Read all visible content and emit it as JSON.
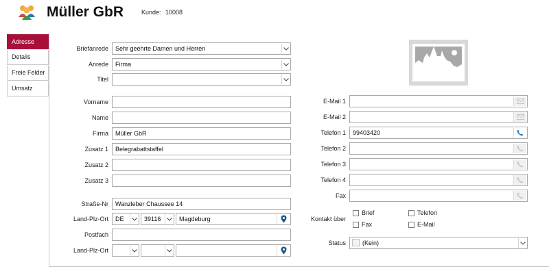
{
  "header": {
    "title": "Müller GbR",
    "kunde_label": "Kunde:",
    "kunde_number": "10008"
  },
  "tabs": [
    {
      "label": "Adresse",
      "active": true
    },
    {
      "label": "Details",
      "active": false
    },
    {
      "label": "Freie Felder",
      "active": false
    },
    {
      "label": "Umsatz",
      "active": false
    }
  ],
  "left_form": {
    "briefanrede": {
      "label": "Briefanrede",
      "value": "Sehr geehrte Damen und Herren"
    },
    "anrede": {
      "label": "Anrede",
      "value": "Firma"
    },
    "titel": {
      "label": "Titel",
      "value": ""
    },
    "vorname": {
      "label": "Vorname",
      "value": ""
    },
    "name": {
      "label": "Name",
      "value": ""
    },
    "firma": {
      "label": "Firma",
      "value": "Müller GbR"
    },
    "zusatz1": {
      "label": "Zusatz 1",
      "value": "Belegrabattstaffel"
    },
    "zusatz2": {
      "label": "Zusatz 2",
      "value": ""
    },
    "zusatz3": {
      "label": "Zusatz 3",
      "value": ""
    },
    "strasse": {
      "label": "Straße-Nr",
      "value": "Wanzleber Chaussee 14"
    },
    "land_plz_ort": {
      "label": "Land-Plz-Ort",
      "land": "DE",
      "plz": "39116",
      "ort": "Magdeburg"
    },
    "postfach": {
      "label": "Postfach",
      "value": ""
    },
    "land_plz_ort2": {
      "label": "Land-Plz-Ort",
      "land": "",
      "plz": "",
      "ort": ""
    }
  },
  "right_form": {
    "email1": {
      "label": "E-Mail 1",
      "value": ""
    },
    "email2": {
      "label": "E-Mail 2",
      "value": ""
    },
    "telefon1": {
      "label": "Telefon 1",
      "value": "99403420"
    },
    "telefon2": {
      "label": "Telefon 2",
      "value": ""
    },
    "telefon3": {
      "label": "Telefon 3",
      "value": ""
    },
    "telefon4": {
      "label": "Telefon 4",
      "value": ""
    },
    "fax": {
      "label": "Fax",
      "value": ""
    },
    "kontakt": {
      "label": "Kontakt über",
      "options": {
        "brief": "Brief",
        "telefon": "Telefon",
        "fax": "Fax",
        "email": "E-Mail"
      }
    },
    "status": {
      "label": "Status",
      "value": "(Kein)"
    }
  },
  "icons": [
    "users-icon",
    "image-placeholder-icon",
    "mail-icon",
    "phone-icon",
    "map-pin-icon",
    "chevron-down-icon"
  ],
  "colors": {
    "active_tab": "#a8103a",
    "phone_active": "#1e6fc0",
    "icon_disabled": "#b8c8d8",
    "pin": "#1a5a8a"
  }
}
